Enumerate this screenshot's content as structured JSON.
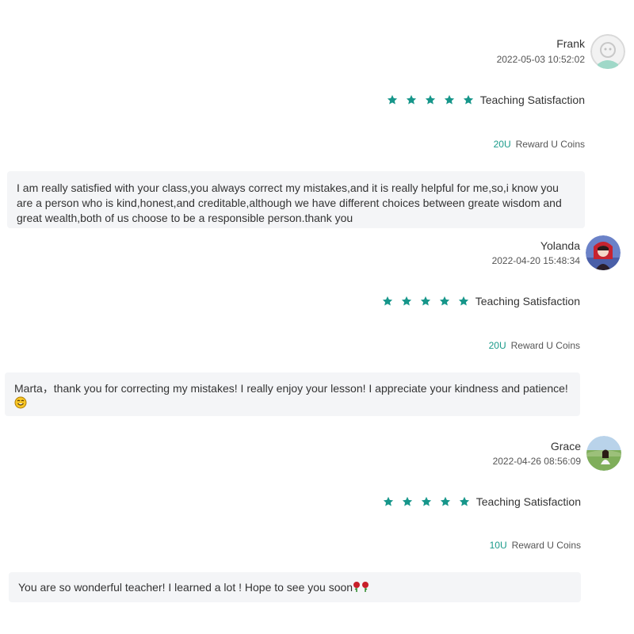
{
  "reviews": [
    {
      "name": "Frank",
      "date": "2022-05-03 10:52:02",
      "rating": 5,
      "satisfaction_label": "Teaching Satisfaction",
      "coin_amount": "20U",
      "coin_label": "Reward U Coins",
      "comment": "I am really satisfied with your class,you always correct my mistakes,and it is really helpful for me,so,i know you are a person who is kind,honest,and creditable,although we have different choices between greate wisdom and great wealth,both of us choose to be a responsible person.thank you",
      "avatar_icon": "default-avatar-icon"
    },
    {
      "name": "Yolanda",
      "date": "2022-04-20 15:48:34",
      "rating": 5,
      "satisfaction_label": "Teaching Satisfaction",
      "coin_amount": "20U",
      "coin_label": "Reward U Coins",
      "comment": "Marta，thank you for correcting my mistakes! I really enjoy your lesson! I appreciate your kindness and patience!",
      "comment_emoji": "smile-emoji-icon",
      "avatar_icon": "user-photo-avatar"
    },
    {
      "name": "Grace",
      "date": "2022-04-26 08:56:09",
      "rating": 5,
      "satisfaction_label": "Teaching Satisfaction",
      "coin_amount": "10U",
      "coin_label": "Reward U Coins",
      "comment": "You are so wonderful teacher! I learned a lot ! Hope to see you soon",
      "comment_emoji": "rose-emoji-icon",
      "avatar_icon": "user-photo-avatar"
    }
  ],
  "colors": {
    "star": "#16968a",
    "coin_amount": "#1a9a8a",
    "comment_bg": "#f4f5f7"
  }
}
